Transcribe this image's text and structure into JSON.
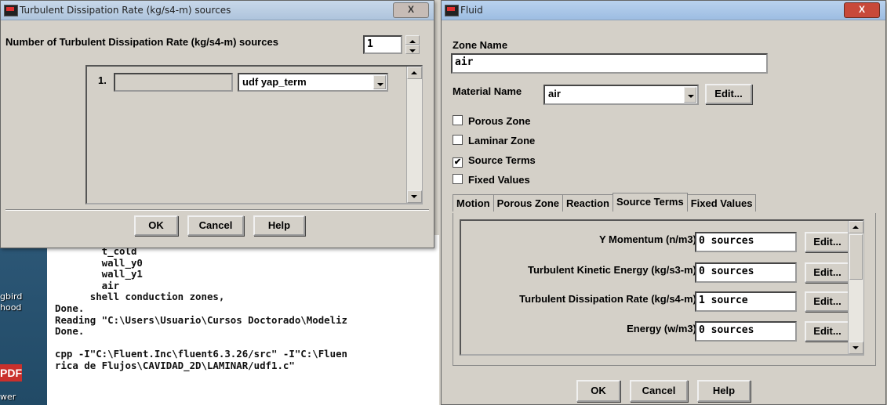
{
  "desktop": {
    "label1": "gbird",
    "label2": "hood",
    "label3": "wer",
    "pdf_icon": "PDF"
  },
  "console": {
    "lines": [
      "        t_cold",
      "        wall_y0",
      "        wall_y1",
      "        air",
      "      shell conduction zones,",
      "Done.",
      "Reading \"C:\\Users\\Usuario\\Cursos Doctorado\\Modeliz",
      "Done.",
      "",
      "cpp -I\"C:\\Fluent.Inc\\fluent6.3.26/src\" -I\"C:\\Fluen",
      "rica de Flujos\\CAVIDAD_2D\\LAMINAR/udf1.c\""
    ]
  },
  "sources_dialog": {
    "title": "Turbulent Dissipation Rate (kg/s4-m) sources",
    "close": "X",
    "count_label": "Number of Turbulent Dissipation Rate (kg/s4-m) sources",
    "count_value": "1",
    "item_index": "1.",
    "item_value": "",
    "item_udf": "udf yap_term",
    "ok": "OK",
    "cancel": "Cancel",
    "help": "Help"
  },
  "fluid_dialog": {
    "title": "Fluid",
    "close": "X",
    "zone_name_label": "Zone Name",
    "zone_name_value": "air",
    "material_label": "Material Name",
    "material_value": "air",
    "edit": "Edit...",
    "options": [
      {
        "label": "Porous Zone",
        "checked": false
      },
      {
        "label": "Laminar Zone",
        "checked": false
      },
      {
        "label": "Source Terms",
        "checked": true
      },
      {
        "label": "Fixed Values",
        "checked": false
      }
    ],
    "tabs": [
      "Motion",
      "Porous Zone",
      "Reaction",
      "Source Terms",
      "Fixed Values"
    ],
    "active_tab": "Source Terms",
    "source_rows": [
      {
        "label": "Y Momentum (n/m3)",
        "value": "0 sources",
        "button": "Edit..."
      },
      {
        "label": "Turbulent Kinetic Energy (kg/s3-m)",
        "value": "0 sources",
        "button": "Edit..."
      },
      {
        "label": "Turbulent Dissipation Rate (kg/s4-m)",
        "value": "1 source",
        "button": "Edit..."
      },
      {
        "label": "Energy (w/m3)",
        "value": "0 sources",
        "button": "Edit..."
      }
    ],
    "ok": "OK",
    "cancel": "Cancel",
    "help": "Help"
  },
  "colors": {
    "dialog_bg": "#d4d0c8",
    "close_button": "#c8493a",
    "title_gradient": "#aec4dc"
  }
}
